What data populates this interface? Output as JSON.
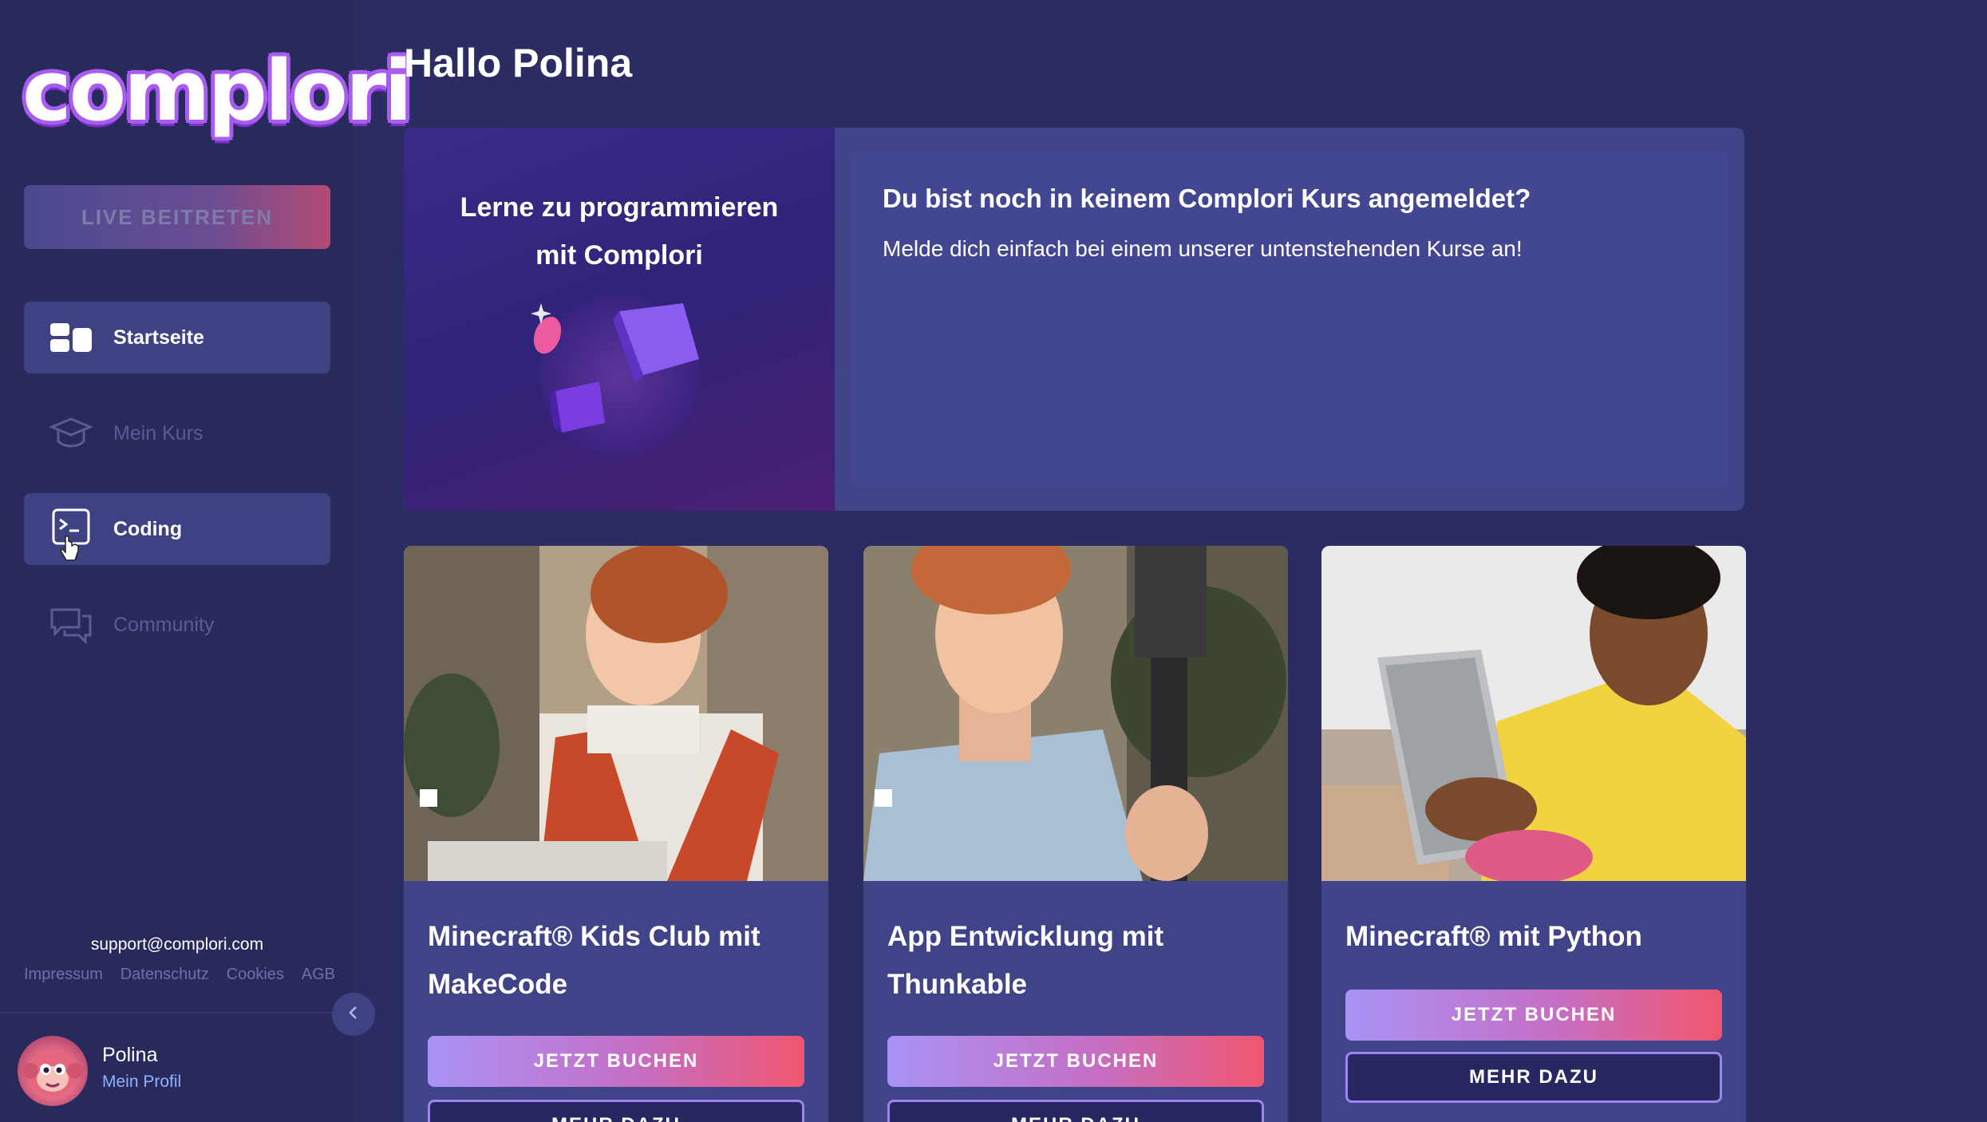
{
  "app": {
    "logo_text": "complori",
    "brand_colors": {
      "primary": "#a85cf0",
      "accent_red": "#f0566f",
      "background": "#2b2d62"
    }
  },
  "sidebar": {
    "live_button_label": "LIVE BEITRETEN",
    "items": [
      {
        "label": "Startseite",
        "icon": "dashboard-icon",
        "state": "active"
      },
      {
        "label": "Mein Kurs",
        "icon": "graduation-cap-icon",
        "state": "disabled"
      },
      {
        "label": "Coding",
        "icon": "terminal-icon",
        "state": "active"
      },
      {
        "label": "Community",
        "icon": "chat-bubbles-icon",
        "state": "disabled"
      }
    ],
    "support_email": "support@complori.com",
    "footer_links": [
      "Impressum",
      "Datenschutz",
      "Cookies",
      "AGB"
    ],
    "collapse_icon": "chevron-left-icon",
    "profile": {
      "name": "Polina",
      "link_label": "Mein Profil",
      "avatar_icon": "monkey-avatar"
    }
  },
  "main": {
    "greeting": "Hallo Polina",
    "hero": {
      "left_title_line1": "Lerne zu programmieren",
      "left_title_line2": "mit Complori",
      "heading": "Du bist noch in keinem Complori Kurs angemeldet?",
      "subtext": "Melde dich einfach bei einem unserer untenstehenden Kurse an!"
    },
    "courses": [
      {
        "title_line1": "Minecraft® Kids Club mit",
        "title_line2": "MakeCode",
        "book_label": "JETZT BUCHEN",
        "more_label": "MEHR DAZU"
      },
      {
        "title_line1": "App Entwicklung mit",
        "title_line2": "Thunkable",
        "book_label": "JETZT BUCHEN",
        "more_label": "MEHR DAZU"
      },
      {
        "title_line1": "Minecraft® mit Python",
        "title_line2": "",
        "book_label": "JETZT BUCHEN",
        "more_label": "MEHR DAZU"
      }
    ]
  }
}
